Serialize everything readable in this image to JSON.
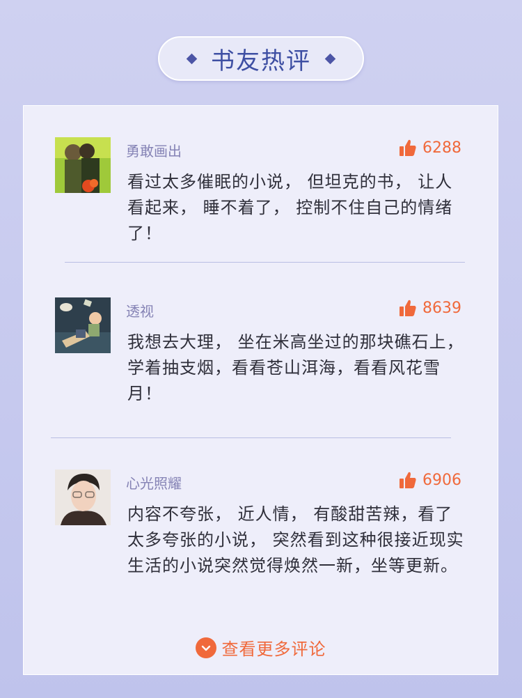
{
  "header": {
    "title": "书友热评"
  },
  "comments": [
    {
      "user": "勇敢画出",
      "likes": "6288",
      "text": "看过太多催眠的小说， 但坦克的书， 让人看起来， 睡不着了， 控制不住自己的情绪了！"
    },
    {
      "user": "透视",
      "likes": "8639",
      "text": "我想去大理， 坐在米高坐过的那块礁石上，学着抽支烟，看看苍山洱海，看看风花雪月！"
    },
    {
      "user": "心光照耀",
      "likes": "6906",
      "text": "内容不夸张， 近人情， 有酸甜苦辣，看了太多夸张的小说， 突然看到这种很接近现实生活的小说突然觉得焕然一新，坐等更新。"
    }
  ],
  "footer": {
    "more_label": "查看更多评论"
  },
  "colors": {
    "accent": "#f0693b",
    "title": "#3e4fa3",
    "username": "#8583b5",
    "background": "#c7caef",
    "card": "#eeeefa"
  },
  "icons": {
    "like": "thumbs-up-icon",
    "more": "chevron-down-circle-icon",
    "title_decoration": "diamond-icon"
  }
}
